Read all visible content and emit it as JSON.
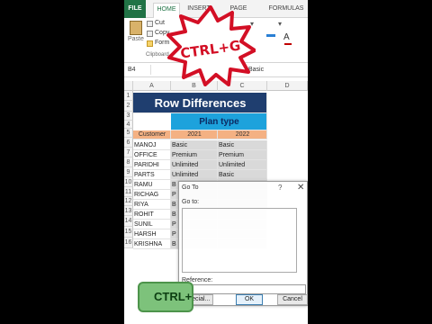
{
  "ribbon": {
    "tabs": [
      "FILE",
      "HOME",
      "INSERT",
      "PAGE LAYOUT",
      "FORMULAS"
    ],
    "clipboard": {
      "cut": "Cut",
      "copy": "Copy",
      "format": "Form",
      "paste": "Paste",
      "group": "Clipboard"
    }
  },
  "overlay": {
    "shortcut_burst": "CTRL+G",
    "keycap": "CTRL+G"
  },
  "formula_bar": {
    "name_box": "B4",
    "value": "Basic"
  },
  "grid": {
    "columns": [
      "A",
      "B",
      "C",
      "D"
    ],
    "row_numbers": [
      "1",
      "2",
      "3",
      "4",
      "5",
      "6",
      "7",
      "8",
      "9",
      "10",
      "11",
      "12",
      "13",
      "14",
      "15",
      "16"
    ],
    "title": "Row Differences",
    "plan_type": "Plan type",
    "header": [
      "Customer",
      "2021",
      "2022"
    ],
    "rows": [
      [
        "MANOJ",
        "Basic",
        "Basic"
      ],
      [
        "OFFICE",
        "Premium",
        "Premium"
      ],
      [
        "PARIDHI",
        "Unlimited",
        "Unlimited"
      ],
      [
        "PARTS",
        "Unlimited",
        "Basic"
      ],
      [
        "RAMU",
        "B",
        ""
      ],
      [
        "RICHAG",
        "P",
        ""
      ],
      [
        "RIYA",
        "B",
        ""
      ],
      [
        "ROHIT",
        "B",
        ""
      ],
      [
        "SUNIL",
        "P",
        ""
      ],
      [
        "HARSH",
        "P",
        ""
      ],
      [
        "KRISHNA",
        "B",
        ""
      ]
    ]
  },
  "dialog": {
    "title": "Go To",
    "help": "?",
    "close": "✕",
    "goto_label": "Go to:",
    "reference_label": "Reference:",
    "special_button": "Special...",
    "ok_button": "OK",
    "cancel_button": "Cancel"
  }
}
